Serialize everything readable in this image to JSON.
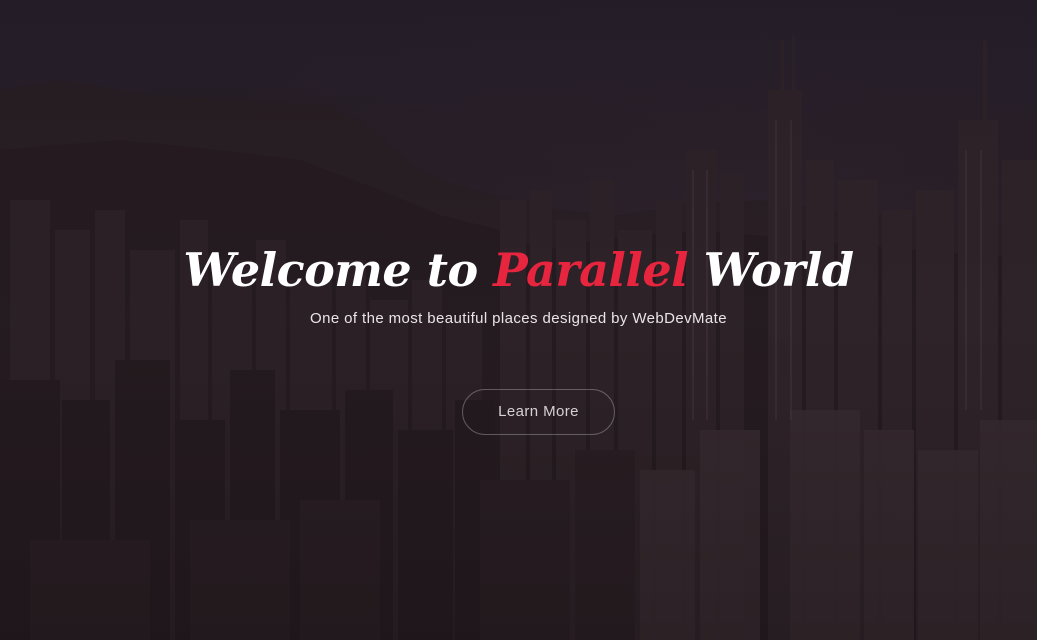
{
  "hero": {
    "title_prefix": "Welcome to ",
    "title_accent": "Parallel",
    "title_suffix": " World",
    "subtitle": "One of the most beautiful places designed by WebDevMate",
    "cta_label": "Learn More"
  },
  "colors": {
    "accent": "#e8253f",
    "text": "#ffffff",
    "overlay": "#241a20"
  }
}
